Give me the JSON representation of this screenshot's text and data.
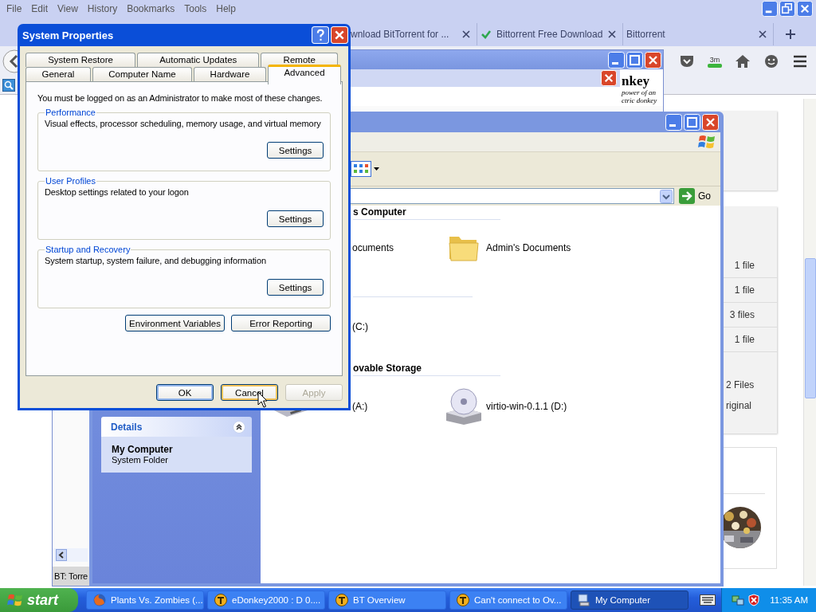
{
  "browser": {
    "menu": [
      "File",
      "Edit",
      "View",
      "History",
      "Bookmarks",
      "Tools",
      "Help"
    ],
    "tabs": [
      {
        "label": "wnload BitTorrent for ...",
        "selected": false,
        "kind": "plain"
      },
      {
        "label": "Bittorrent Free Download",
        "selected": false,
        "kind": "check"
      },
      {
        "label": "Bittorrent",
        "selected": false,
        "kind": "plain"
      }
    ],
    "toolbar_badge": "3m",
    "page": {
      "file_counts": [
        "1 file",
        "1 file",
        "3 files",
        "1 file"
      ],
      "summary": [
        "2 Files",
        "riginal"
      ]
    }
  },
  "back_window": {
    "logo_lines": [
      "nkey",
      "power of an",
      "ctric donkey"
    ],
    "status_text": "BT: Torre"
  },
  "my_computer": {
    "go_label": "Go",
    "groups": [
      {
        "heading": "s Computer",
        "items": [
          {
            "label": "ocuments"
          },
          {
            "label": "Admin's Documents",
            "kind": "folder"
          }
        ]
      },
      {
        "items": [
          {
            "label": "(C:)"
          }
        ]
      },
      {
        "heading": "ovable Storage",
        "items": [
          {
            "label": "(A:)",
            "kind": "floppy"
          },
          {
            "label": "virtio-win-0.1.1 (D:)",
            "kind": "cd"
          }
        ]
      }
    ],
    "details": {
      "title": "Details",
      "name": "My Computer",
      "type": "System Folder"
    }
  },
  "dialog": {
    "title": "System Properties",
    "tab_rows": [
      [
        {
          "label": "System Restore",
          "selected": false
        },
        {
          "label": "Automatic Updates",
          "selected": false
        },
        {
          "label": "Remote",
          "selected": false
        }
      ],
      [
        {
          "label": "General",
          "selected": false
        },
        {
          "label": "Computer Name",
          "selected": false
        },
        {
          "label": "Hardware",
          "selected": false
        },
        {
          "label": "Advanced",
          "selected": true
        }
      ]
    ],
    "notice": "You must be logged on as an Administrator to make most of these changes.",
    "groups": [
      {
        "title": "Performance",
        "text": "Visual effects, processor scheduling, memory usage, and virtual memory",
        "button": "Settings"
      },
      {
        "title": "User Profiles",
        "text": "Desktop settings related to your logon",
        "button": "Settings"
      },
      {
        "title": "Startup and Recovery",
        "text": "System startup, system failure, and debugging information",
        "button": "Settings"
      }
    ],
    "extra_buttons": [
      "Environment Variables",
      "Error Reporting"
    ],
    "buttons": [
      {
        "label": "OK",
        "default": true,
        "hovered": false,
        "disabled": false
      },
      {
        "label": "Cancel",
        "default": false,
        "hovered": true,
        "disabled": false
      },
      {
        "label": "Apply",
        "default": false,
        "hovered": false,
        "disabled": true
      }
    ]
  },
  "taskbar": {
    "start": "start",
    "tasks": [
      {
        "label": "Plants Vs. Zombies (...",
        "kind": "firefox",
        "selected": false
      },
      {
        "label": "eDonkey2000 : D 0....",
        "kind": "bt",
        "selected": false
      },
      {
        "label": "BT Overview",
        "kind": "bt",
        "selected": false
      },
      {
        "label": "Can't connect to Ov...",
        "kind": "bt",
        "selected": false
      },
      {
        "label": "My Computer",
        "kind": "computer",
        "selected": true
      }
    ],
    "clock": "11:35 AM"
  }
}
